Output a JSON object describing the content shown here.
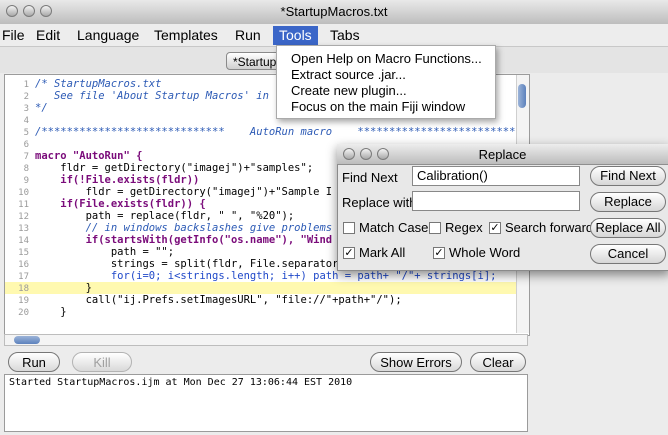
{
  "window": {
    "title": "*StartupMacros.txt"
  },
  "menubar": {
    "items": [
      "File",
      "Edit",
      "Language",
      "Templates",
      "Run",
      "Tools",
      "Tabs"
    ]
  },
  "tab": {
    "label": "*StartupMacros.txt"
  },
  "tools_menu": {
    "items": [
      "Open Help on Macro Functions...",
      "Extract source .jar...",
      "Create new plugin...",
      "Focus on the main Fiji window"
    ]
  },
  "editor": {
    "highlighted_line": 18,
    "lines": [
      {
        "n": "1",
        "t": "/* StartupMacros.txt"
      },
      {
        "n": "2",
        "t": "   See file 'About Startup Macros' in"
      },
      {
        "n": "3",
        "t": "*/"
      },
      {
        "n": "4",
        "t": ""
      },
      {
        "n": "5",
        "t": "/*****************************    AutoRun macro    *****************************"
      },
      {
        "n": "6",
        "t": ""
      },
      {
        "n": "7",
        "t": "macro \"AutoRun\" {"
      },
      {
        "n": "8",
        "t": "    fldr = getDirectory(\"imagej\")+\"samples\";"
      },
      {
        "n": "9",
        "t": "    if(!File.exists(fldr))"
      },
      {
        "n": "10",
        "t": "        fldr = getDirectory(\"imagej\")+\"Sample I"
      },
      {
        "n": "11",
        "t": "    if(File.exists(fldr)) {"
      },
      {
        "n": "12",
        "t": "        path = replace(fldr, \" \", \"%20\");"
      },
      {
        "n": "13",
        "t": "        // in windows backslashes give problems"
      },
      {
        "n": "14",
        "t": "        if(startsWith(getInfo(\"os.name\"), \"Wind"
      },
      {
        "n": "15",
        "t": "            path = \"\";"
      },
      {
        "n": "16",
        "t": "            strings = split(fldr, File.separator);"
      },
      {
        "n": "17",
        "t": "            for(i=0; i<strings.length; i++) path = path+ \"/\"+ strings[i];"
      },
      {
        "n": "18",
        "t": "        }"
      },
      {
        "n": "19",
        "t": "        call(\"ij.Prefs.setImagesURL\", \"file://\"+path+\"/\");"
      },
      {
        "n": "20",
        "t": "    }"
      }
    ]
  },
  "buttons": {
    "run": "Run",
    "kill": "Kill",
    "show_errors": "Show Errors",
    "clear": "Clear"
  },
  "console": {
    "text": "Started StartupMacros.ijm at Mon Dec 27 13:06:44 EST 2010"
  },
  "replace_dialog": {
    "title": "Replace",
    "find_label": "Find Next",
    "find_value": "Calibration()",
    "replace_label": "Replace with",
    "replace_value": "",
    "match_case": {
      "label": "Match Case",
      "checked": false
    },
    "regex": {
      "label": "Regex",
      "checked": false
    },
    "search_forward": {
      "label": "Search forward",
      "checked": true
    },
    "mark_all": {
      "label": "Mark All",
      "checked": true
    },
    "whole_word": {
      "label": "Whole Word",
      "checked": true
    },
    "btn_find_next": "Find Next",
    "btn_replace": "Replace",
    "btn_replace_all": "Replace All",
    "btn_cancel": "Cancel"
  },
  "colors": {
    "menu_highlight": "#3b66c8",
    "line_highlight": "#fff9b0",
    "comment": "#2c5ab5",
    "keyword": "#7a0b7a",
    "string": "#b0281b"
  }
}
